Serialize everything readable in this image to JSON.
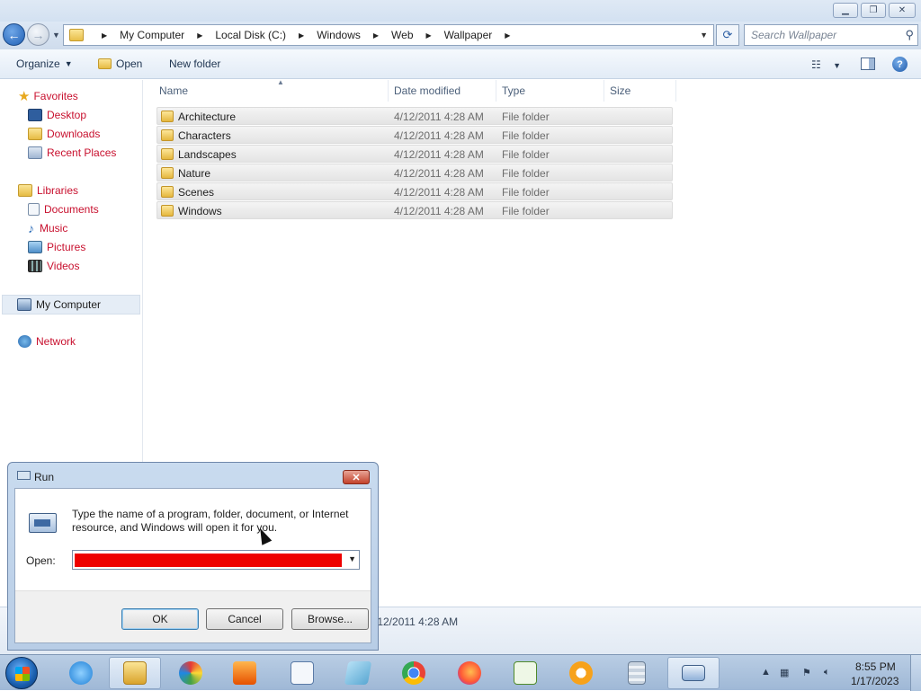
{
  "window": {
    "address": {
      "crumbs": [
        "My Computer",
        "Local Disk (C:)",
        "Windows",
        "Web",
        "Wallpaper"
      ],
      "search_placeholder": "Search Wallpaper"
    },
    "toolbar": {
      "organize_label": "Organize",
      "open_label": "Open",
      "new_folder_label": "New folder"
    },
    "nav": {
      "favorites": "Favorites",
      "desktop": "Desktop",
      "downloads": "Downloads",
      "recent_places": "Recent Places",
      "libraries": "Libraries",
      "documents": "Documents",
      "music": "Music",
      "pictures": "Pictures",
      "videos": "Videos",
      "my_computer": "My Computer",
      "network": "Network"
    },
    "columns": {
      "name": "Name",
      "date": "Date modified",
      "type": "Type",
      "size": "Size"
    },
    "rows": [
      {
        "name": "Architecture",
        "date": "4/12/2011 4:28 AM",
        "type": "File folder"
      },
      {
        "name": "Characters",
        "date": "4/12/2011 4:28 AM",
        "type": "File folder"
      },
      {
        "name": "Landscapes",
        "date": "4/12/2011 4:28 AM",
        "type": "File folder"
      },
      {
        "name": "Nature",
        "date": "4/12/2011 4:28 AM",
        "type": "File folder"
      },
      {
        "name": "Scenes",
        "date": "4/12/2011 4:28 AM",
        "type": "File folder"
      },
      {
        "name": "Windows",
        "date": "4/12/2011 4:28 AM",
        "type": "File folder"
      }
    ],
    "details_date": "/12/2011 4:28 AM"
  },
  "run_dialog": {
    "title": "Run",
    "description": "Type the name of a program, folder, document, or Internet resource, and Windows will open it for you.",
    "open_label": "Open:",
    "input_value": "",
    "ok_label": "OK",
    "cancel_label": "Cancel",
    "browse_label": "Browse..."
  },
  "taskbar": {
    "apps": [
      "internet-explorer-icon",
      "file-explorer-icon",
      "paint-icon",
      "media-player-icon",
      "wordpad-icon",
      "notepad-icon",
      "chrome-icon",
      "firefox-icon",
      "spreadsheet-icon",
      "password-manager-icon",
      "calculator-icon",
      "run-icon"
    ],
    "time": "8:55 PM",
    "date": "1/17/2023"
  },
  "colors": {
    "nav_link": "#c8102e",
    "run_input_fill": "#ee0000"
  }
}
